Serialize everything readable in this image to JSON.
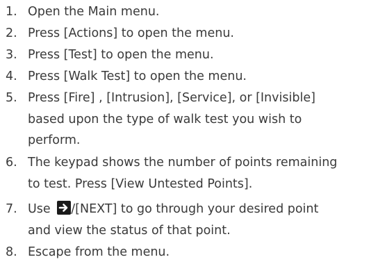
{
  "steps": [
    {
      "number": "1.",
      "lines": [
        "Open the Main menu."
      ]
    },
    {
      "number": "2.",
      "lines": [
        "Press [Actions] to open the menu."
      ]
    },
    {
      "number": "3.",
      "lines": [
        "Press [Test] to open the menu."
      ]
    },
    {
      "number": "4.",
      "lines": [
        "Press [Walk Test] to open the menu."
      ]
    },
    {
      "number": "5.",
      "lines": [
        "Press [Fire] , [Intrusion], [Service], or [Invisible]",
        "based upon the type of walk test you wish to",
        "perform."
      ]
    },
    {
      "number": "6.",
      "lines": [
        "The keypad shows the number of points remaining",
        "to test. Press [View Untested Points]."
      ]
    },
    {
      "number": "7.",
      "line1_prefix": "Use ",
      "line1_suffix": "/[NEXT] to go through your desired point",
      "line2": "and view the status of that point.",
      "icon": "right-arrow-icon"
    },
    {
      "number": "8.",
      "lines": [
        "Escape from the menu."
      ]
    }
  ]
}
